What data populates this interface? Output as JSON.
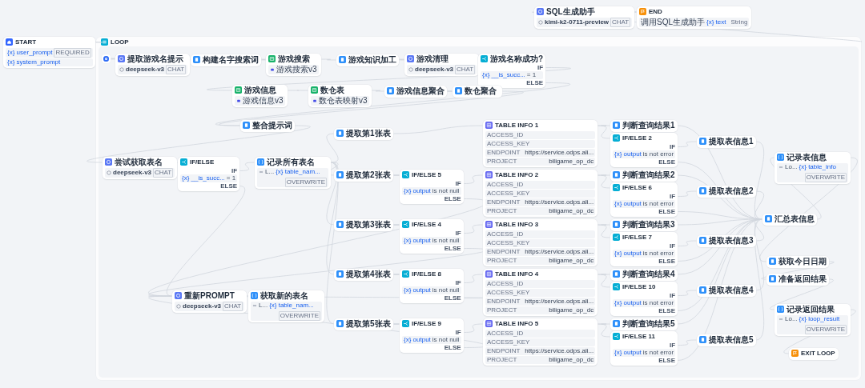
{
  "nodes": [
    {
      "kind": "start",
      "title": "START",
      "params": [
        {
          "name": "{x} user_prompt",
          "tag": "REQUIRED"
        },
        {
          "name": "{x} system_prompt"
        }
      ]
    },
    {
      "kind": "llm",
      "title": "SQL生成助手",
      "model": {
        "name": "kimi-k2-0711-preview",
        "tag": "CHAT"
      }
    },
    {
      "kind": "end",
      "title": "END",
      "output": {
        "label": "调用SQL生成助手",
        "variable": "{x} text",
        "type": "String"
      }
    }
  ],
  "loop": {
    "title": "LOOP",
    "nodes": [
      {
        "kind": "llm",
        "title": "提取游戏名提示",
        "model": {
          "name": "deepseek-v3",
          "tag": "CHAT"
        }
      },
      {
        "kind": "code",
        "title": "构建名字搜索词"
      },
      {
        "kind": "knowledge",
        "title": "游戏搜索",
        "dataset": "游戏搜索v3"
      },
      {
        "kind": "code",
        "title": "游戏知识加工"
      },
      {
        "kind": "llm",
        "title": "游戏清理",
        "model": {
          "name": "deepseek-v3",
          "tag": "CHAT"
        }
      },
      {
        "kind": "ifelse",
        "title": "游戏名称成功?",
        "branches": [
          "IF",
          "ELSE"
        ],
        "condition": {
          "variable": "{x} __is_succ...",
          "operator": "= 1"
        }
      },
      {
        "kind": "knowledge",
        "title": "游戏信息",
        "dataset": "游戏信息v3"
      },
      {
        "kind": "knowledge",
        "title": "数仓表",
        "dataset": "数仓表映射v3"
      },
      {
        "kind": "code",
        "title": "游戏信息聚合"
      },
      {
        "kind": "code",
        "title": "数仓聚合"
      },
      {
        "kind": "code",
        "title": "整合提示词"
      },
      {
        "kind": "llm",
        "title": "尝试获取表名",
        "model": {
          "name": "deepseek-v3",
          "tag": "CHAT"
        }
      },
      {
        "kind": "ifelse",
        "title": "IF/ELSE",
        "branches": [
          "IF",
          "ELSE"
        ],
        "condition": {
          "variable": "{x} __is_succ...",
          "operator": "= 1"
        }
      },
      {
        "kind": "variable",
        "title": "记录所有表名",
        "prefix": "L...",
        "variable": "{x} table_nam...",
        "mode": "OVERWRITE"
      },
      {
        "kind": "code",
        "title": "提取第1张表"
      },
      {
        "kind": "code",
        "title": "提取第2张表"
      },
      {
        "kind": "code",
        "title": "提取第3张表"
      },
      {
        "kind": "code",
        "title": "提取第4张表"
      },
      {
        "kind": "code",
        "title": "提取第5张表"
      },
      {
        "kind": "ifelse",
        "title": "IF/ELSE 5",
        "branches": [
          "IF",
          "ELSE"
        ],
        "condition": {
          "variable": "{x} output",
          "operator": "is not null"
        }
      },
      {
        "kind": "ifelse",
        "title": "IF/ELSE 4",
        "branches": [
          "IF",
          "ELSE"
        ],
        "condition": {
          "variable": "{x} output",
          "operator": "is not null"
        }
      },
      {
        "kind": "ifelse",
        "title": "IF/ELSE 8",
        "branches": [
          "IF",
          "ELSE"
        ],
        "condition": {
          "variable": "{x} output",
          "operator": "is not null"
        }
      },
      {
        "kind": "ifelse",
        "title": "IF/ELSE 9",
        "branches": [
          "IF",
          "ELSE"
        ],
        "condition": {
          "variable": "{x} output",
          "operator": "is not null"
        }
      },
      {
        "kind": "table",
        "title": "TABLE INFO 1",
        "rows": [
          {
            "key": "ACCESS_ID"
          },
          {
            "key": "ACCESS_KEY"
          },
          {
            "key": "ENDPOINT",
            "value": "https://service.odps.ali..."
          },
          {
            "key": "PROJECT",
            "value": "biligame_op_dc"
          }
        ]
      },
      {
        "kind": "table",
        "title": "TABLE INFO 2",
        "rows": [
          {
            "key": "ACCESS_ID"
          },
          {
            "key": "ACCESS_KEY"
          },
          {
            "key": "ENDPOINT",
            "value": "https://service.odps.ali..."
          },
          {
            "key": "PROJECT",
            "value": "biligame_op_dc"
          }
        ]
      },
      {
        "kind": "table",
        "title": "TABLE INFO 3",
        "rows": [
          {
            "key": "ACCESS_ID"
          },
          {
            "key": "ACCESS_KEY"
          },
          {
            "key": "ENDPOINT",
            "value": "https://service.odps.ali..."
          },
          {
            "key": "PROJECT",
            "value": "biligame_op_dc"
          }
        ]
      },
      {
        "kind": "table",
        "title": "TABLE INFO 4",
        "rows": [
          {
            "key": "ACCESS_ID"
          },
          {
            "key": "ACCESS_KEY"
          },
          {
            "key": "ENDPOINT",
            "value": "https://service.odps.ali..."
          },
          {
            "key": "PROJECT",
            "value": "biligame_op_dc"
          }
        ]
      },
      {
        "kind": "table",
        "title": "TABLE INFO 5",
        "rows": [
          {
            "key": "ACCESS_ID"
          },
          {
            "key": "ACCESS_KEY"
          },
          {
            "key": "ENDPOINT",
            "value": "https://service.odps.ali..."
          },
          {
            "key": "PROJECT",
            "value": "biligame_op_dc"
          }
        ]
      },
      {
        "kind": "code",
        "title": "判断查询结果1"
      },
      {
        "kind": "ifelse",
        "title": "IF/ELSE 2",
        "branches": [
          "IF",
          "ELSE"
        ],
        "condition": {
          "variable": "{x} output",
          "operator": "is not error"
        }
      },
      {
        "kind": "code",
        "title": "判断查询结果2"
      },
      {
        "kind": "ifelse",
        "title": "IF/ELSE 6",
        "branches": [
          "IF",
          "ELSE"
        ],
        "condition": {
          "variable": "{x} output",
          "operator": "is not error"
        }
      },
      {
        "kind": "code",
        "title": "判断查询结果3"
      },
      {
        "kind": "ifelse",
        "title": "IF/ELSE 7",
        "branches": [
          "IF",
          "ELSE"
        ],
        "condition": {
          "variable": "{x} output",
          "operator": "is not error"
        }
      },
      {
        "kind": "code",
        "title": "判断查询结果4"
      },
      {
        "kind": "ifelse",
        "title": "IF/ELSE 10",
        "branches": [
          "IF",
          "ELSE"
        ],
        "condition": {
          "variable": "{x} output",
          "operator": "is not error"
        }
      },
      {
        "kind": "code",
        "title": "判断查询结果5"
      },
      {
        "kind": "ifelse",
        "title": "IF/ELSE 11",
        "branches": [
          "IF",
          "ELSE"
        ],
        "condition": {
          "variable": "{x} output",
          "operator": "is not error"
        }
      },
      {
        "kind": "code",
        "title": "提取表信息1"
      },
      {
        "kind": "code",
        "title": "提取表信息2"
      },
      {
        "kind": "code",
        "title": "提取表信息3"
      },
      {
        "kind": "code",
        "title": "提取表信息4"
      },
      {
        "kind": "code",
        "title": "提取表信息5"
      },
      {
        "kind": "variable",
        "title": "记录表信息",
        "prefix": "Lo...",
        "variable": "{x} table_info",
        "mode": "OVERWRITE"
      },
      {
        "kind": "code",
        "title": "汇总表信息"
      },
      {
        "kind": "code",
        "title": "获取今日日期"
      },
      {
        "kind": "code",
        "title": "准备返回结果"
      },
      {
        "kind": "variable",
        "title": "记录返回结果",
        "prefix": "Lo...",
        "variable": "{x} loop_result",
        "mode": "OVERWRITE"
      },
      {
        "kind": "exit",
        "title": "EXIT LOOP"
      },
      {
        "kind": "llm",
        "title": "重新PROMPT",
        "model": {
          "name": "deepseek-v3",
          "tag": "CHAT"
        }
      },
      {
        "kind": "variable",
        "title": "获取新的表名",
        "prefix": "L...",
        "variable": "{x} table_nam...",
        "mode": "OVERWRITE"
      }
    ]
  }
}
